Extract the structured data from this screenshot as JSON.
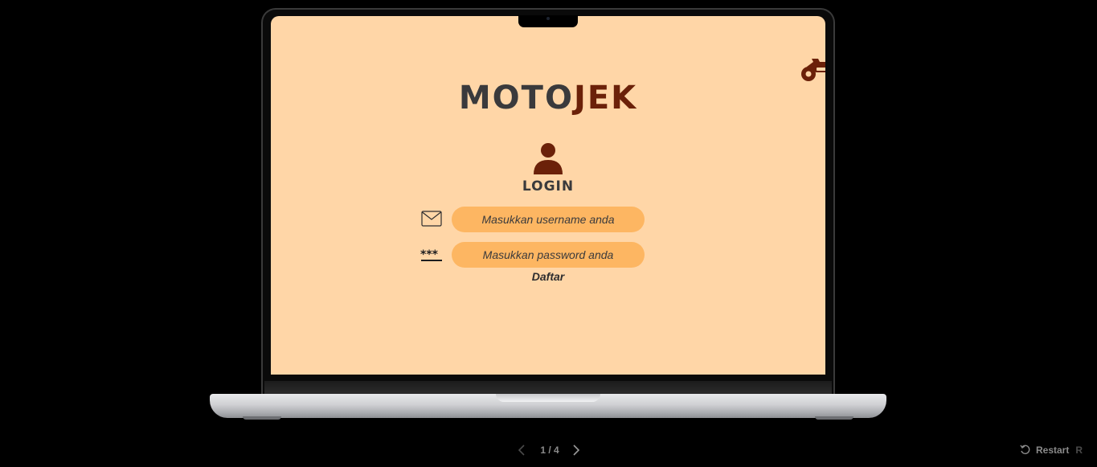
{
  "app": {
    "brand_part1": "MOTO",
    "brand_part2": "JEK",
    "login_title": "LOGIN",
    "username_placeholder": "Masukkan username anda",
    "password_placeholder": "Masukkan password anda",
    "register_link": "Daftar",
    "icons": {
      "logo": "motorbike-icon",
      "user": "user-icon",
      "username": "mail-icon",
      "password": "password-icon"
    },
    "colors": {
      "screen_bg": "#FFD6A7",
      "input_bg": "#FDB662",
      "accent": "#6B2109",
      "text": "#3a3a3c"
    }
  },
  "viewer": {
    "page_counter": "1 / 4",
    "restart_label": "Restart",
    "restart_shortcut": "R"
  }
}
